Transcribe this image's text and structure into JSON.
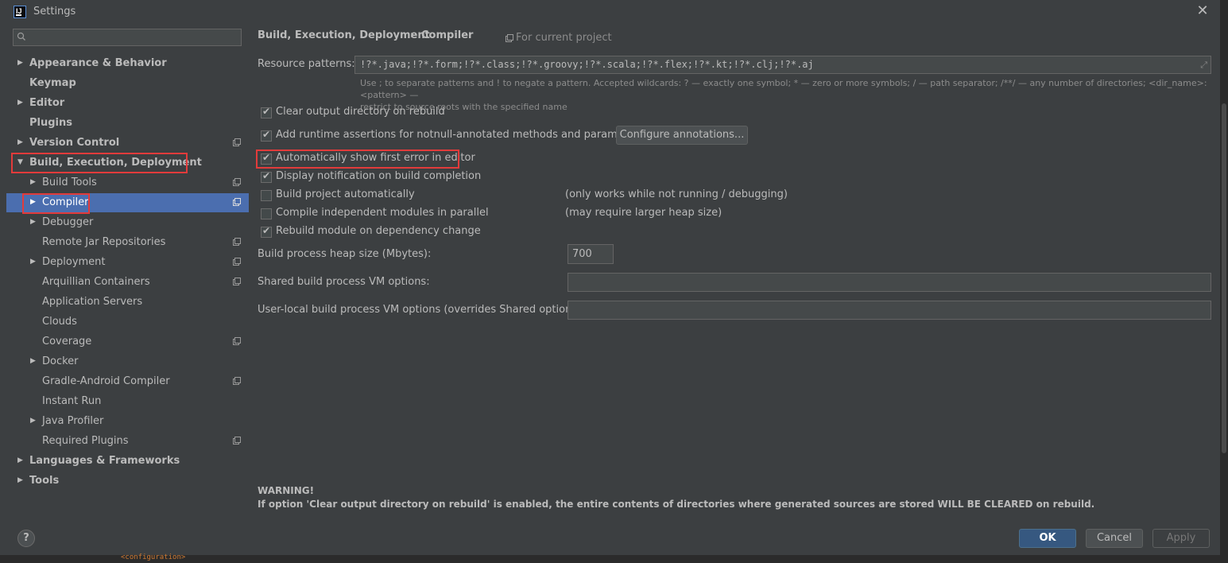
{
  "window": {
    "title": "Settings"
  },
  "search": {
    "placeholder": ""
  },
  "sidebar": {
    "items": [
      {
        "label": "Appearance & Behavior"
      },
      {
        "label": "Keymap"
      },
      {
        "label": "Editor"
      },
      {
        "label": "Plugins"
      },
      {
        "label": "Version Control"
      },
      {
        "label": "Build, Execution, Deployment"
      },
      {
        "label": "Build Tools"
      },
      {
        "label": "Compiler"
      },
      {
        "label": "Debugger"
      },
      {
        "label": "Remote Jar Repositories"
      },
      {
        "label": "Deployment"
      },
      {
        "label": "Arquillian Containers"
      },
      {
        "label": "Application Servers"
      },
      {
        "label": "Clouds"
      },
      {
        "label": "Coverage"
      },
      {
        "label": "Docker"
      },
      {
        "label": "Gradle-Android Compiler"
      },
      {
        "label": "Instant Run"
      },
      {
        "label": "Java Profiler"
      },
      {
        "label": "Required Plugins"
      },
      {
        "label": "Languages & Frameworks"
      },
      {
        "label": "Tools"
      }
    ]
  },
  "header": {
    "crumb_parent": "Build, Execution, Deployment",
    "crumb_sep": "›",
    "crumb_current": "Compiler",
    "scope": "For current project"
  },
  "resource": {
    "label": "Resource patterns:",
    "value": "!?*.java;!?*.form;!?*.class;!?*.groovy;!?*.scala;!?*.flex;!?*.kt;!?*.clj;!?*.aj",
    "hint_line1": "Use ; to separate patterns and ! to negate a pattern. Accepted wildcards: ? — exactly one symbol; * — zero or more symbols; / — path separator; /**/ — any number of directories; <dir_name>:<pattern> —",
    "hint_line2": "restrict to source roots with the specified name"
  },
  "options": {
    "clear_output": "Clear output directory on rebuild",
    "runtime_assertions": "Add runtime assertions for notnull-annotated methods and parameters",
    "configure_annotations": "Configure annotations...",
    "show_first_error": "Automatically show first error in editor",
    "display_notification": "Display notification on build completion",
    "build_auto": "Build project automatically",
    "build_auto_note": "(only works while not running / debugging)",
    "compile_parallel": "Compile independent modules in parallel",
    "compile_parallel_note": "(may require larger heap size)",
    "rebuild_module": "Rebuild module on dependency change"
  },
  "heap": {
    "label": "Build process heap size (Mbytes):",
    "value": "700"
  },
  "shared_vm": {
    "label": "Shared build process VM options:",
    "value": ""
  },
  "user_vm": {
    "label": "User-local build process VM options (overrides Shared options):",
    "value": ""
  },
  "warning": {
    "title": "WARNING!",
    "text": "If option 'Clear output directory on rebuild' is enabled, the entire contents of directories where generated sources are stored WILL BE CLEARED on rebuild."
  },
  "footer": {
    "help": "?",
    "ok": "OK",
    "cancel": "Cancel",
    "apply": "Apply"
  },
  "background_code": "<configuration>"
}
